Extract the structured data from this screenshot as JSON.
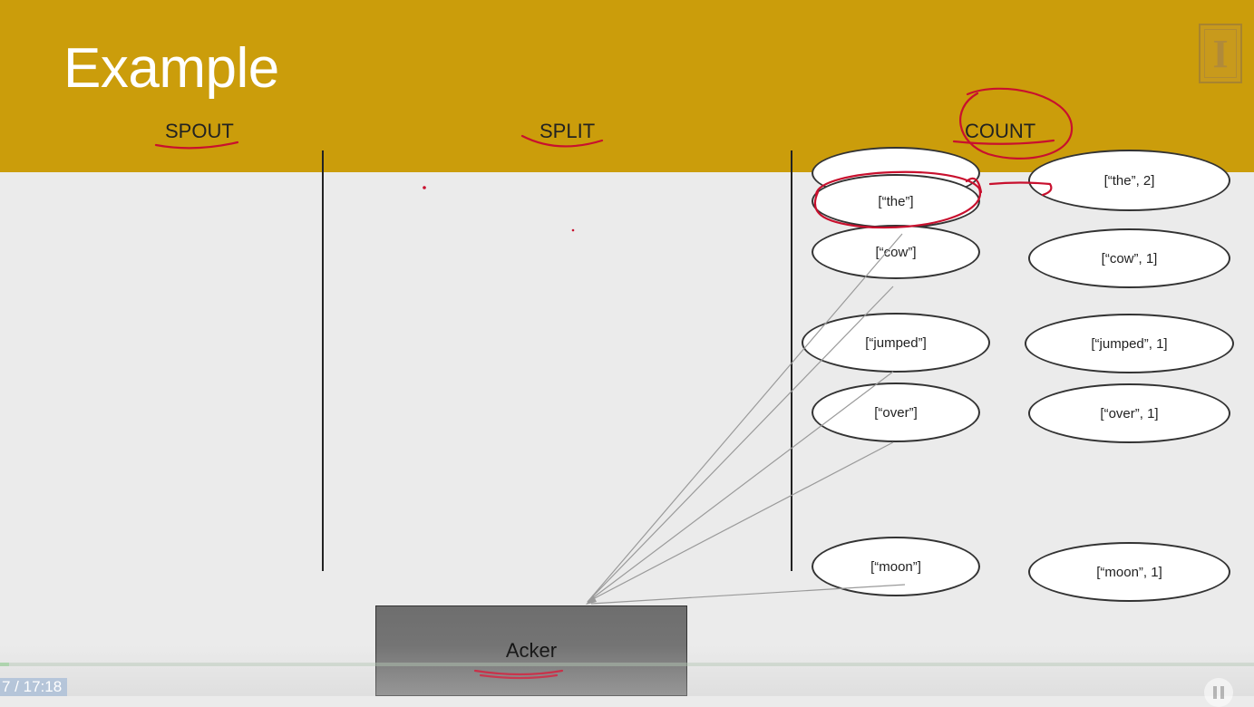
{
  "slide": {
    "title": "Example",
    "columns": {
      "spout": "SPOUT",
      "split": "SPLIT",
      "count": "COUNT"
    }
  },
  "split_nodes": [
    {
      "label": ""
    },
    {
      "label": "[“the”]"
    },
    {
      "label": "[“cow”]"
    },
    {
      "label": "[“jumped”]"
    },
    {
      "label": "[“over”]"
    },
    {
      "label": "[“moon”]"
    }
  ],
  "count_nodes": [
    {
      "label": "[“the”, 2]"
    },
    {
      "label": "[“cow”, 1]"
    },
    {
      "label": "[“jumped”, 1]"
    },
    {
      "label": "[“over”, 1]"
    },
    {
      "label": "[“moon”, 1]"
    }
  ],
  "acker": {
    "label": "Acker"
  },
  "player": {
    "time": "7 / 17:18",
    "progress": 0.007,
    "pause_icon": "pause-icon"
  },
  "colors": {
    "header": "#cb9d0b",
    "annotation": "#c8102e",
    "background": "#ebebeb"
  }
}
